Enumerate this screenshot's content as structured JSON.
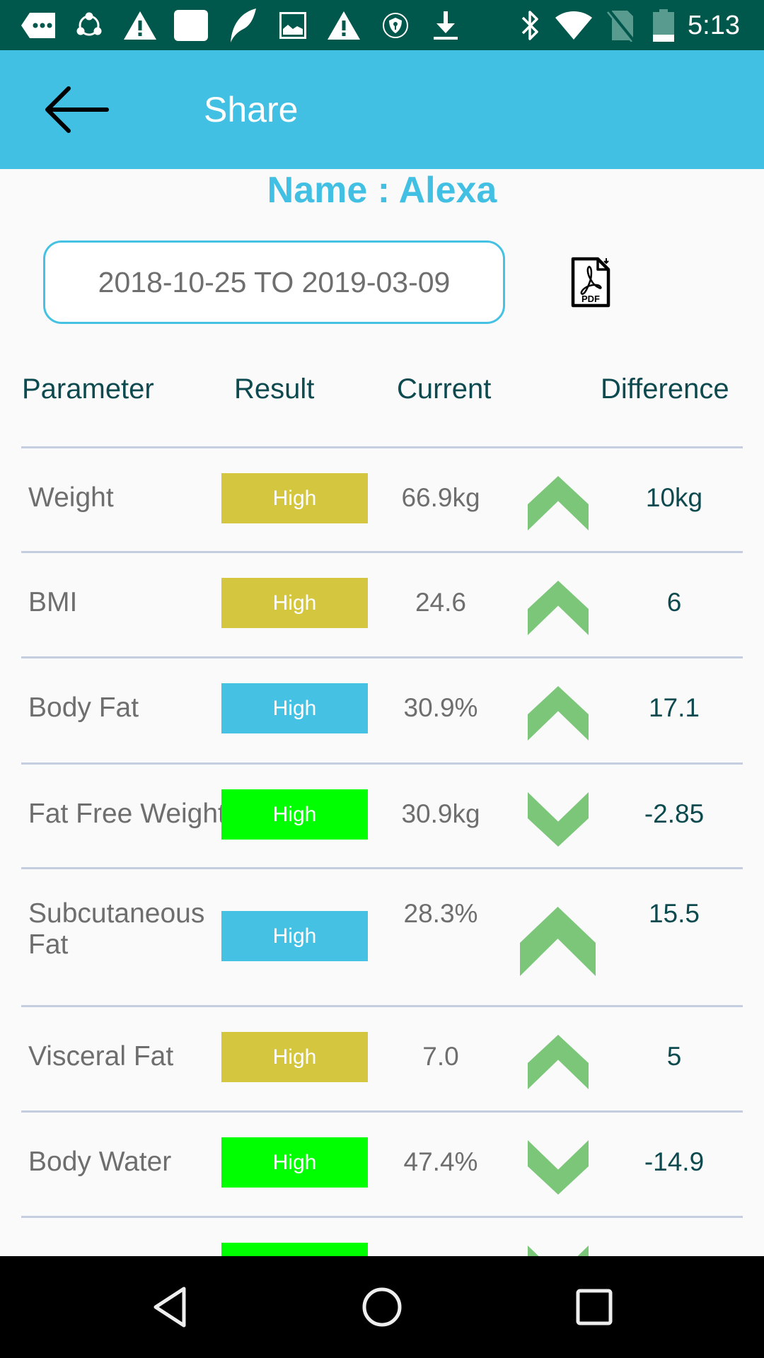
{
  "status_bar": {
    "time": "5:13",
    "left_icons": [
      "message-icon",
      "shareit-icon",
      "warning-icon",
      "square-app-icon",
      "feather-icon",
      "image-icon",
      "warning-icon",
      "vpn-shield-icon",
      "download-icon"
    ],
    "right_icons": [
      "bluetooth-icon",
      "wifi-icon",
      "no-sim-icon",
      "battery-icon"
    ]
  },
  "app_bar": {
    "title": "Share",
    "back_icon": "arrow-back-icon"
  },
  "profile": {
    "name_label": "Name : Alexa"
  },
  "date_range": {
    "value": "2018-10-25 TO 2019-03-09"
  },
  "pdf_button": {
    "icon": "pdf-file-icon",
    "label": "PDF"
  },
  "table": {
    "headers": [
      "Parameter",
      "Result",
      "Current",
      "Difference"
    ],
    "rows": [
      {
        "parameter": "Weight",
        "result": "High",
        "result_color": "#d4c63f",
        "current": "66.9kg",
        "trend": "up",
        "difference": "10kg"
      },
      {
        "parameter": "BMI",
        "result": "High",
        "result_color": "#d4c63f",
        "current": "24.6",
        "trend": "up",
        "difference": "6"
      },
      {
        "parameter": "Body Fat",
        "result": "High",
        "result_color": "#45c1e3",
        "current": "30.9%",
        "trend": "up",
        "difference": "17.1"
      },
      {
        "parameter": "Fat Free Weight",
        "result": "High",
        "result_color": "#00ff00",
        "current": "30.9kg",
        "trend": "down",
        "difference": "-2.85"
      },
      {
        "parameter": "Subcutaneous Fat",
        "result": "High",
        "result_color": "#45c1e3",
        "current": "28.3%",
        "trend": "up",
        "difference": "15.5"
      },
      {
        "parameter": "Visceral Fat",
        "result": "High",
        "result_color": "#d4c63f",
        "current": "7.0",
        "trend": "up",
        "difference": "5"
      },
      {
        "parameter": "Body Water",
        "result": "High",
        "result_color": "#00ff00",
        "current": "47.4%",
        "trend": "down",
        "difference": "-14.9"
      },
      {
        "parameter": "",
        "result": "",
        "result_color": "#00ff00",
        "current": "",
        "trend": "down",
        "difference": ""
      }
    ]
  },
  "colors": {
    "status_bar": "#00574b",
    "accent": "#42c0e3",
    "trend_arrow": "#7cc67a",
    "header_text": "#0d4a4f",
    "body_text": "#6e6e6e",
    "divider": "#c5cde0"
  },
  "nav_bar": {
    "buttons": [
      "back-triangle-icon",
      "home-circle-icon",
      "recents-square-icon"
    ]
  }
}
